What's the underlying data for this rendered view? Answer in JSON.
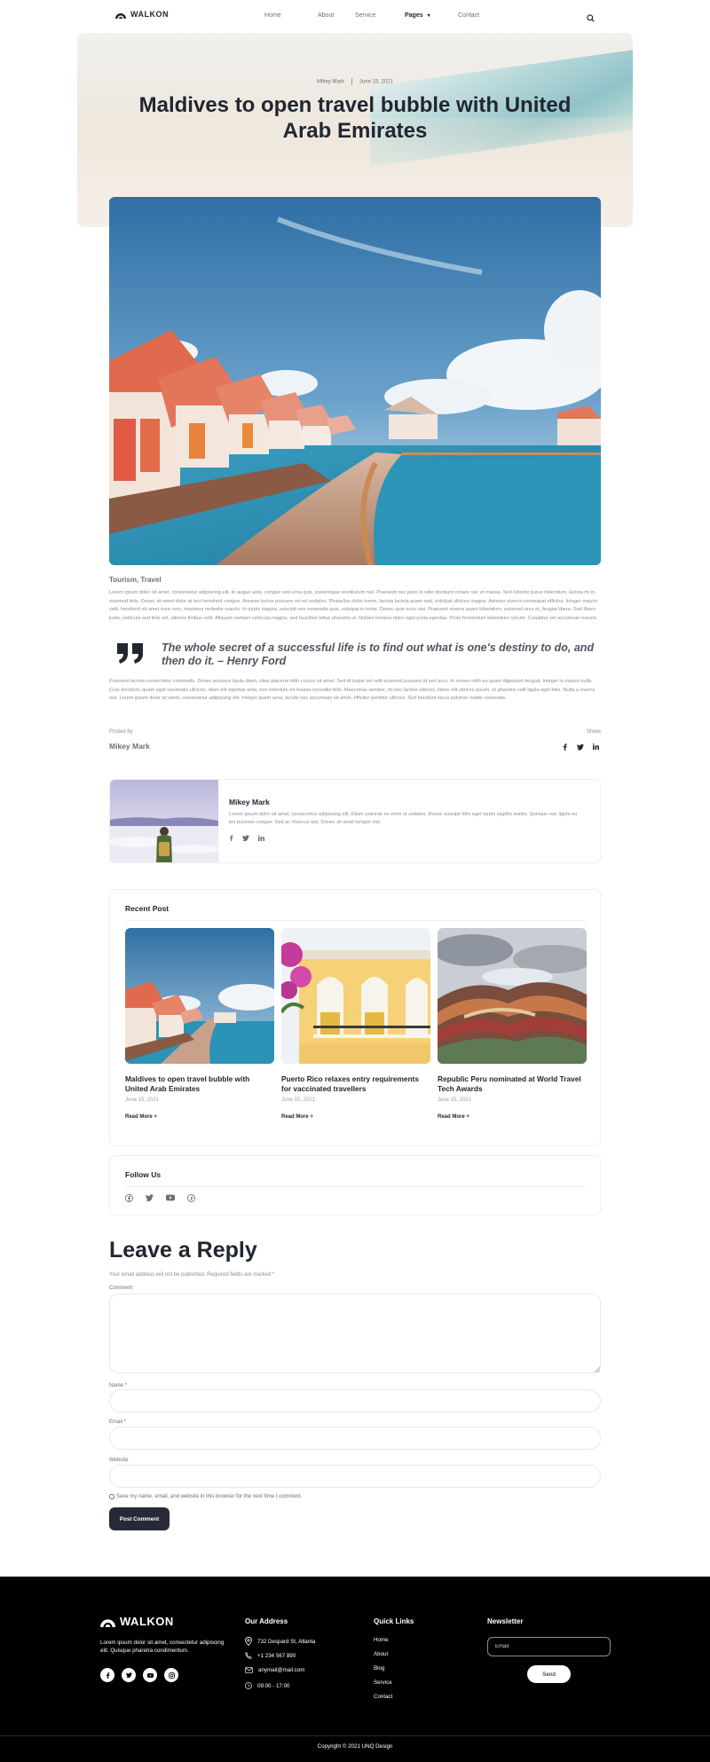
{
  "header": {
    "logo_text": "WALKON",
    "nav": [
      "Home",
      "About",
      "Service",
      "Pages",
      "Contact"
    ],
    "active_nav": "Pages"
  },
  "hero": {
    "author": "Mikey Mark",
    "date": "June 15, 2021",
    "title": "Maldives to open travel bubble with United Arab Emirates"
  },
  "article": {
    "categories": "Tourism, Travel",
    "para1": "Lorem ipsum dolor sit amet, consectetur adipiscing elit. In augue ante, congue sed urna quis, scelerisque vestibulum nisl. Praesent nec justo id odio tincidunt ornare nec et massa. Sed lobortis purus bibendum, lacinia mi in, euismod felis. Donec sit amet dolor at orci hendrerit congue. Aenean luctus posuere mi vel sodales. Phasellus dolor lorem, lacinia lacinia quam sed, volutpat ultrices magna. Aenean viverra consequat efficitur. Integer mauris velit, hendrerit sit amet nunc non, maximus molestie mauris. In turpis magna, suscipit non venenatis quis, volutpat in tortor. Donec quis nunc nisi. Praesent viverra quam bibendum, euismod arcu et, feugiat libero. Sed libero justo, vehicula sed felis vel, ultrices finibus velit. Aliquam semper vehicula magna, sed faucibus tellus pharetra ut. Nullam tempus dolor eget porta egestas. Proin fermentum bibendum rutrum. Curabitur vel accumsan mauris.",
    "quote": "The whole secret of a successful life is to find out what is one's destiny to do, and then do it. – Henry Ford",
    "para2": "Praesent lacinia consectetur commodo. Donec posuere ligula diam, vitae placerat nibh cursus sit amet. Sed id turpis vel velit euismod posuere id sed arcu. In ornare nibh eu quam dignissim feugiat. Integer in massa nulla. Cras tincidunt, quam eget venenatis ultrices, diam elit egestas ante, non interdum mi massa convallis felis. Maecenas semper, mi nec lacinia ultrices, libero elit ultrices ipsum, et pharetra velit ligula eget felis. Nulla a viverra nisl. Lorem ipsum dolor sit amet, consectetur adipiscing elit. Integer quam urna, iaculis nec accumsan sit amet, efficitur porttitor ultrices. Sed tincidunt lacus pulvinar mattis venenatis.",
    "posted_by_label": "Posted by",
    "posted_by_name": "Mikey Mark",
    "share_label": "Share"
  },
  "author_card": {
    "name": "Mikey Mark",
    "bio": "Lorem ipsum dolor sit amet, consectetur adipiscing elit. Etiam pulvinar ex enim ut sodales. Donec suscipit felis eget turpis sagittis mattis. Quisque nec ligula eu leo pulvinar congue. Sed ac rhoncus nisl. Donec sit amet tempor nisl."
  },
  "recent": {
    "title": "Recent Post",
    "read_more": "Read More +",
    "posts": [
      {
        "title": "Maldives to open travel bubble with United Arab Emirates",
        "date": "June 15, 2021"
      },
      {
        "title": "Puerto Rico relaxes entry requirements for vaccinated travellers",
        "date": "June 15, 2021"
      },
      {
        "title": "Republic Peru nominated at World Travel Tech Awards",
        "date": "June 15, 2021"
      }
    ]
  },
  "follow": {
    "title": "Follow Us"
  },
  "reply": {
    "title": "Leave a Reply",
    "note": "Your email address will not be published. Required fields are marked *",
    "comment_label": "Comment",
    "name_label": "Name *",
    "email_label": "Email *",
    "website_label": "Website",
    "save_label": "Save my name, email, and website in this browser for the next time I comment.",
    "button": "Post Comment"
  },
  "footer": {
    "logo_text": "WALKON",
    "about": "Lorem ipsum dolor sit amet, consectetur adipiscing elit. Quisque pharetra condimentum.",
    "address_title": "Our Address",
    "address": "732 Despard St, Atlanta",
    "phone": "+1 234 567 890",
    "email": "anymail@mail.com",
    "hours": "09:00 - 17:00",
    "links_title": "Quick Links",
    "links": [
      "Home",
      "About",
      "Blog",
      "Service",
      "Contact"
    ],
    "newsletter_title": "Newsletter",
    "email_placeholder": "Email",
    "send": "Send",
    "copyright": "Copyright © 2021 UNQ Design"
  },
  "colors": {
    "dark": "#222630",
    "button": "#272a36",
    "muted": "#8a8e96",
    "footer_bg": "#000000"
  }
}
